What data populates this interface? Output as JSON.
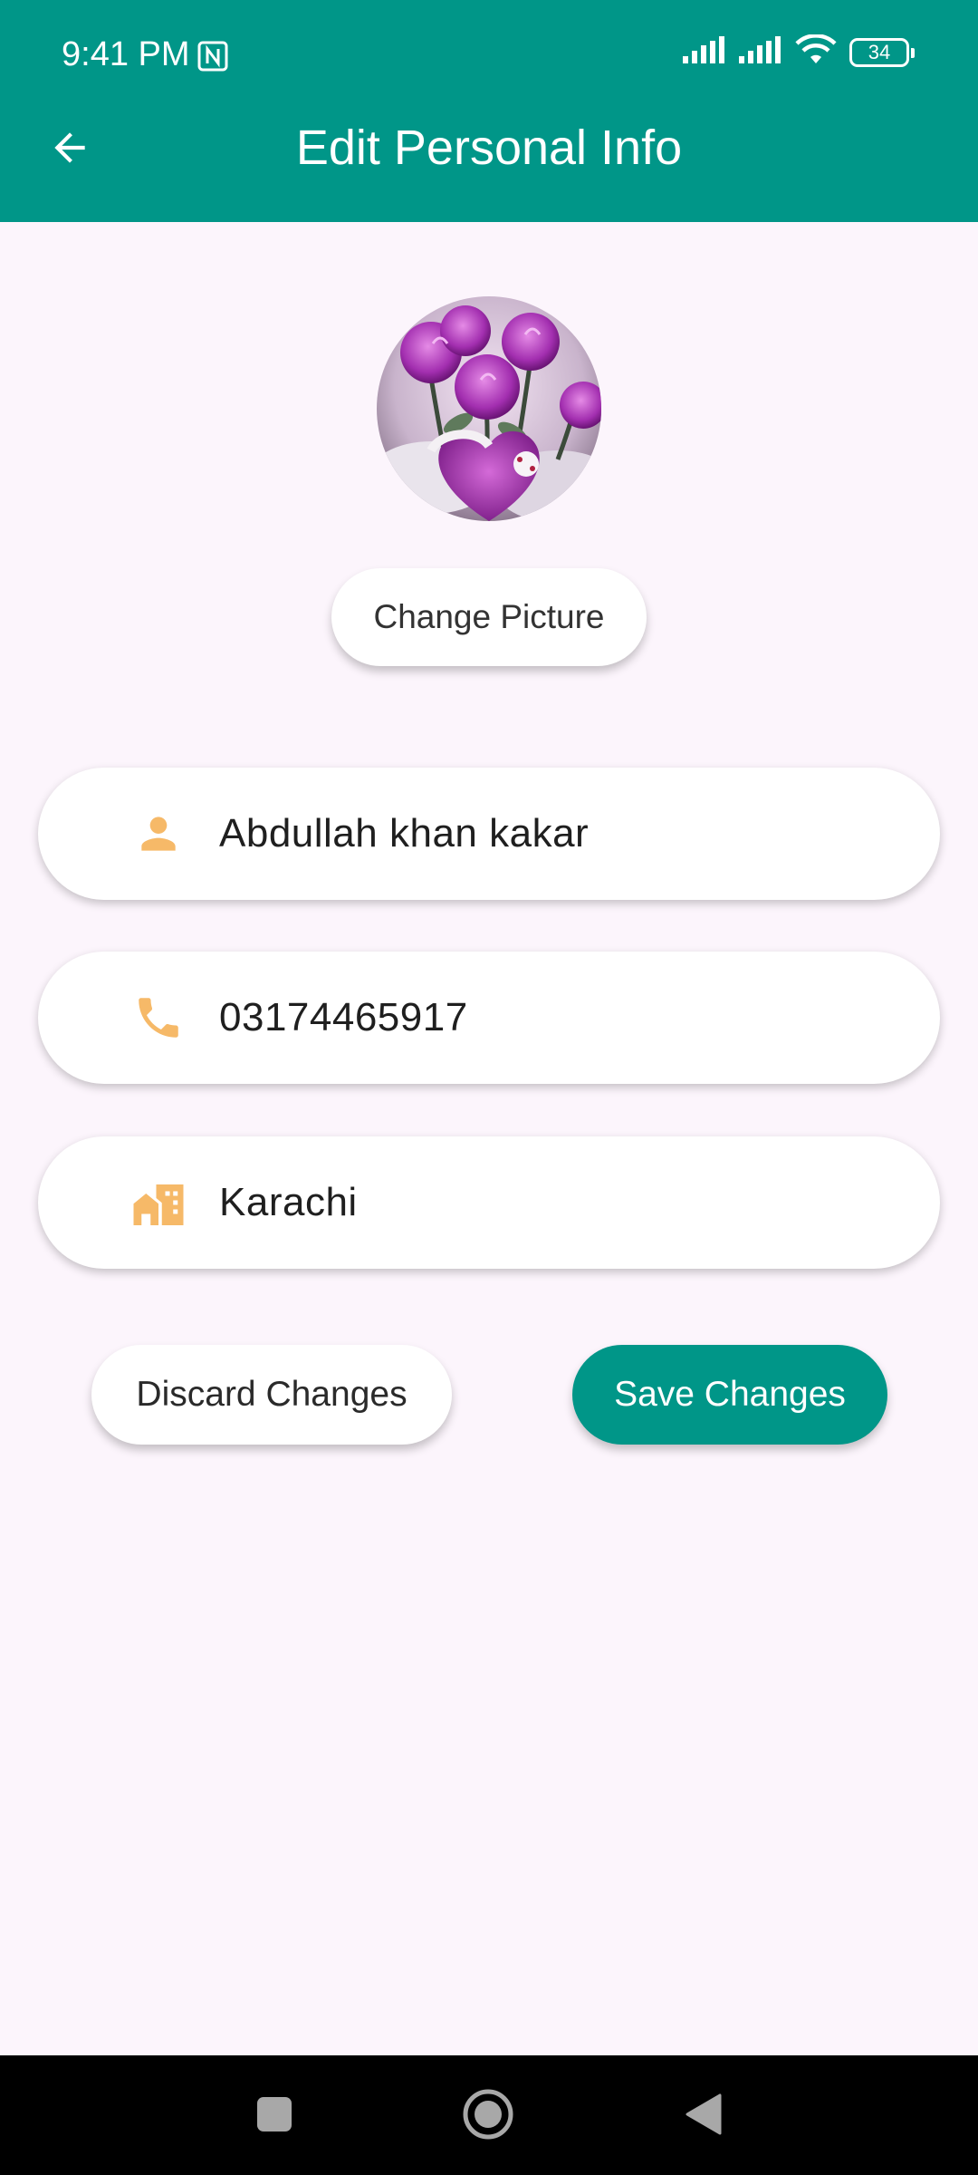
{
  "status_bar": {
    "time": "9:41 PM",
    "battery_level": "34",
    "icons": [
      "nfc-icon",
      "signal-icon",
      "signal-icon",
      "wifi-icon",
      "battery-icon"
    ]
  },
  "app_bar": {
    "title": "Edit Personal Info",
    "back_icon": "arrow-back-icon"
  },
  "profile": {
    "avatar": "profile-picture",
    "change_picture_label": "Change Picture"
  },
  "fields": {
    "name": {
      "icon": "person-icon",
      "value": "Abdullah khan kakar"
    },
    "phone": {
      "icon": "phone-icon",
      "value": "03174465917"
    },
    "city": {
      "icon": "city-icon",
      "value": "Karachi"
    }
  },
  "actions": {
    "discard_label": "Discard Changes",
    "save_label": "Save Changes"
  },
  "colors": {
    "primary": "#009688",
    "background": "#fcf5fc",
    "icon_accent": "#f6b968"
  },
  "nav_bar": {
    "icons": [
      "recents-icon",
      "home-icon",
      "back-triangle-icon"
    ]
  }
}
